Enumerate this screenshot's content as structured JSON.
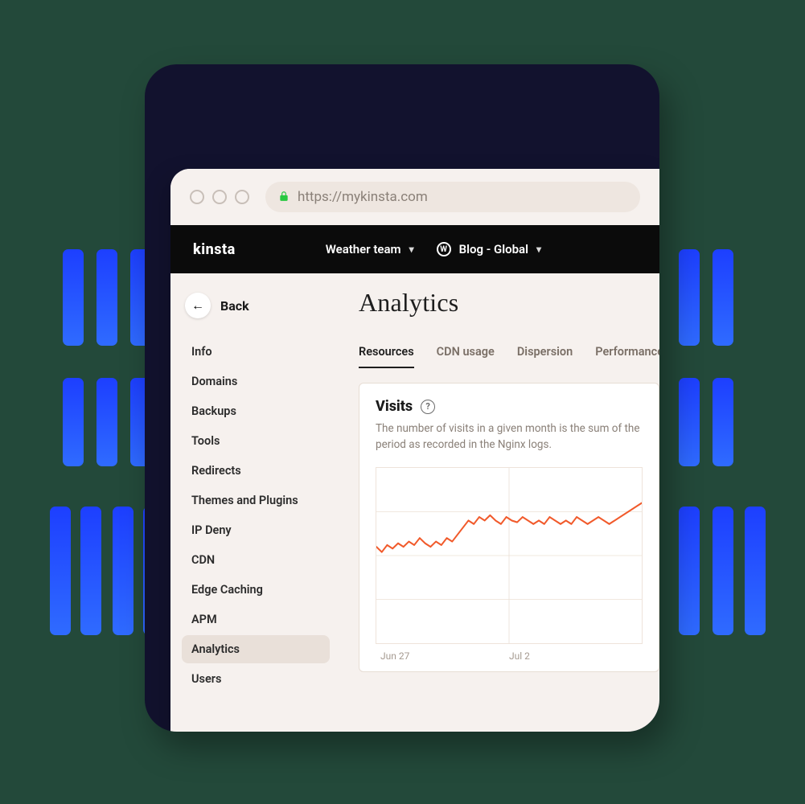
{
  "browser": {
    "url": "https://mykinsta.com"
  },
  "appbar": {
    "brand": "kinsta",
    "team_label": "Weather team",
    "site_label": "Blog - Global"
  },
  "sidebar": {
    "back_label": "Back",
    "items": [
      {
        "label": "Info"
      },
      {
        "label": "Domains"
      },
      {
        "label": "Backups"
      },
      {
        "label": "Tools"
      },
      {
        "label": "Redirects"
      },
      {
        "label": "Themes and Plugins"
      },
      {
        "label": "IP Deny"
      },
      {
        "label": "CDN"
      },
      {
        "label": "Edge Caching"
      },
      {
        "label": "APM"
      },
      {
        "label": "Analytics",
        "active": true
      },
      {
        "label": "Users"
      }
    ]
  },
  "main": {
    "title": "Analytics",
    "tabs": [
      {
        "label": "Resources",
        "active": true
      },
      {
        "label": "CDN usage"
      },
      {
        "label": "Dispersion"
      },
      {
        "label": "Performance"
      }
    ],
    "visits": {
      "title": "Visits",
      "description": "The number of visits in a given month is the sum of the period as recorded in the Nginx logs.",
      "xlabels": [
        "Jun 27",
        "Jul 2"
      ]
    }
  },
  "chart_data": {
    "type": "line",
    "title": "Visits",
    "xlabel": "",
    "ylabel": "",
    "x_tick_labels": [
      "Jun 27",
      "Jul 2"
    ],
    "ylim": [
      0,
      100
    ],
    "series": [
      {
        "name": "Visits",
        "color": "#f15a2b",
        "values": [
          55,
          52,
          56,
          54,
          57,
          55,
          58,
          56,
          60,
          57,
          55,
          58,
          56,
          60,
          58,
          62,
          66,
          70,
          68,
          72,
          70,
          73,
          70,
          68,
          72,
          70,
          69,
          72,
          70,
          68,
          70,
          68,
          72,
          70,
          68,
          70,
          68,
          72,
          70,
          68,
          70,
          72,
          70,
          68,
          70,
          72,
          74,
          76,
          78,
          80
        ]
      }
    ]
  },
  "colors": {
    "accent_orange": "#f15a2b",
    "accent_blue": "#2f6bff",
    "panel_dark": "#12122e",
    "page_bg": "#23493a"
  }
}
